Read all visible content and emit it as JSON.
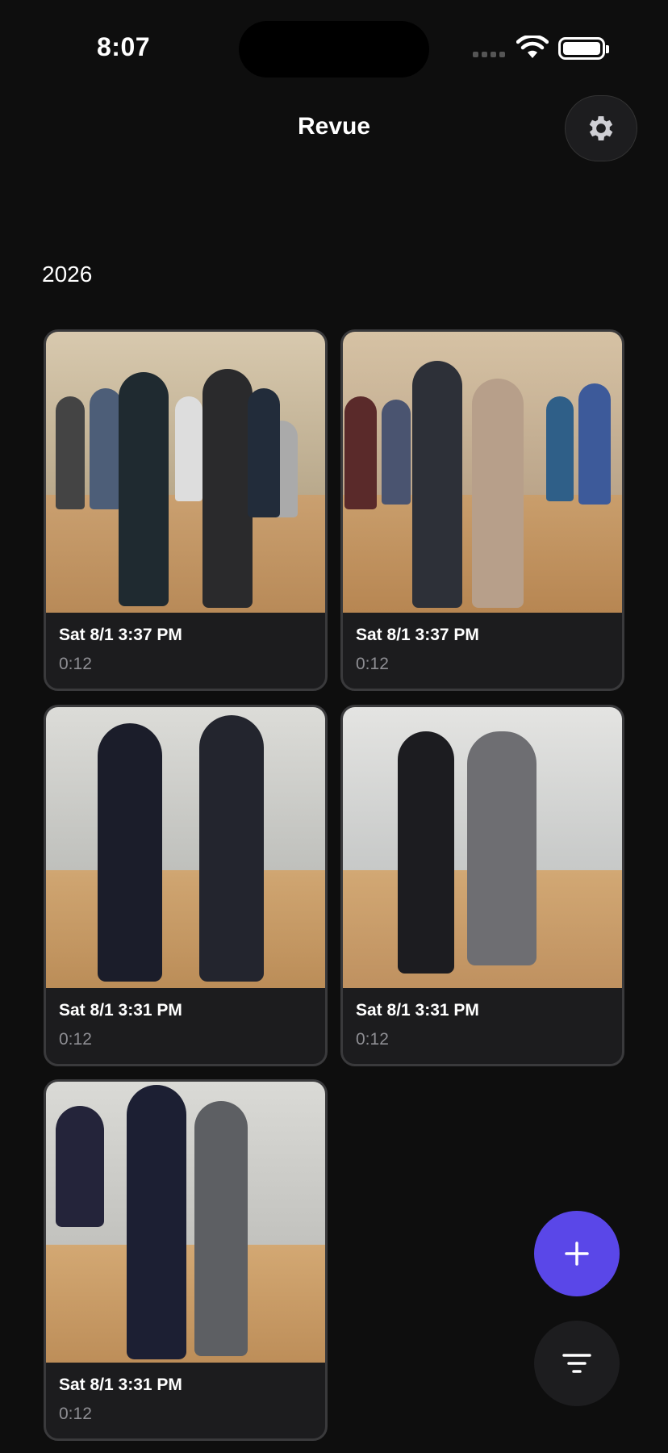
{
  "status": {
    "time": "8:07"
  },
  "header": {
    "title": "Revue",
    "settings_icon": "gear-icon"
  },
  "section": {
    "year": "2026"
  },
  "videos": [
    {
      "title": "Sat 8/1 3:37 PM",
      "duration": "0:12"
    },
    {
      "title": "Sat 8/1 3:37 PM",
      "duration": "0:12"
    },
    {
      "title": "Sat 8/1 3:31 PM",
      "duration": "0:12"
    },
    {
      "title": "Sat 8/1 3:31 PM",
      "duration": "0:12"
    },
    {
      "title": "Sat 8/1 3:31 PM",
      "duration": "0:12"
    }
  ],
  "fab": {
    "add_icon": "plus-icon",
    "filter_icon": "filter-icon"
  },
  "colors": {
    "accent": "#5a47e8",
    "background": "#0e0e0e",
    "card": "#1c1c1e"
  }
}
